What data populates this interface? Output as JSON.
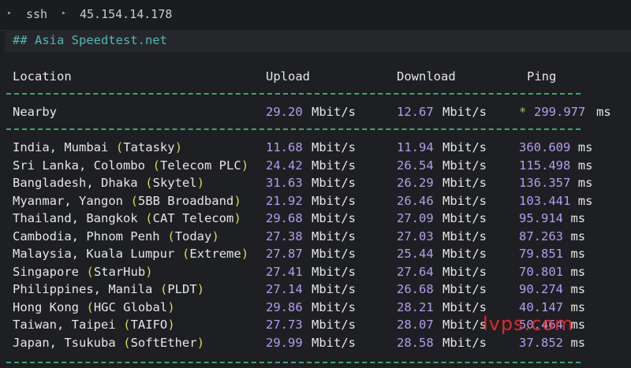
{
  "tab": {
    "label": "ssh",
    "host": "45.154.14.178"
  },
  "heading": "## Asia Speedtest.net",
  "columns": {
    "location": "Location",
    "upload": "Upload",
    "download": "Download",
    "ping": "Ping"
  },
  "nearby": {
    "location": "Nearby",
    "upload": "29.20",
    "download": "12.67",
    "ping_prefix": "*",
    "ping": "299.977",
    "unit_rate": "Mbit/s",
    "unit_ping": "ms"
  },
  "rows": [
    {
      "place": "India, Mumbai ",
      "isp": "Tatasky",
      "upload": "11.68",
      "download": "11.94",
      "ping": "360.609"
    },
    {
      "place": "Sri Lanka, Colombo ",
      "isp": "Telecom PLC",
      "upload": "24.42",
      "download": "26.54",
      "ping": "115.498"
    },
    {
      "place": "Bangladesh, Dhaka ",
      "isp": "Skytel",
      "upload": "31.63",
      "download": "26.29",
      "ping": "136.357"
    },
    {
      "place": "Myanmar, Yangon ",
      "isp": "5BB Broadband",
      "upload": "21.92",
      "download": "26.46",
      "ping": "103.441"
    },
    {
      "place": "Thailand, Bangkok ",
      "isp": "CAT Telecom",
      "upload": "29.68",
      "download": "27.09",
      "ping": "95.914"
    },
    {
      "place": "Cambodia, Phnom Penh ",
      "isp": "Today",
      "upload": "27.38",
      "download": "27.03",
      "ping": "87.263"
    },
    {
      "place": "Malaysia, Kuala Lumpur ",
      "isp": "Extreme",
      "upload": "27.87",
      "download": "25.44",
      "ping": "79.851"
    },
    {
      "place": "Singapore ",
      "isp": "StarHub",
      "upload": "27.41",
      "download": "27.64",
      "ping": "70.801"
    },
    {
      "place": "Philippines, Manila ",
      "isp": "PLDT",
      "upload": "27.14",
      "download": "26.68",
      "ping": "90.274"
    },
    {
      "place": "Hong Kong ",
      "isp": "HGC Global",
      "upload": "29.86",
      "download": "28.21",
      "ping": "40.147"
    },
    {
      "place": "Taiwan, Taipei ",
      "isp": "TAIFO",
      "upload": "27.73",
      "download": "28.07",
      "ping": "50.464"
    },
    {
      "place": "Japan, Tsukuba ",
      "isp": "SoftEther",
      "upload": "29.99",
      "download": "28.58",
      "ping": "37.852"
    }
  ],
  "unit_rate": "Mbit/s",
  "unit_ping": "ms",
  "watermark": "lvps.com"
}
